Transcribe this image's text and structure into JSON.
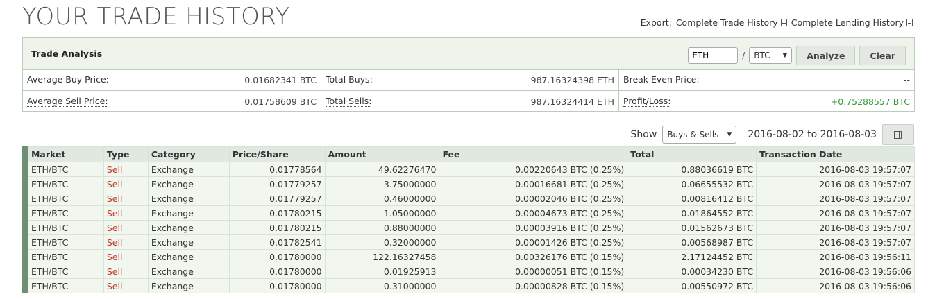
{
  "title": "YOUR TRADE HISTORY",
  "export": {
    "label": "Export:",
    "complete_trade_history": "Complete Trade History",
    "complete_lending_history": "Complete Lending History"
  },
  "analysis": {
    "title": "Trade Analysis",
    "currency_input": "ETH",
    "separator": "/",
    "base_select": "BTC",
    "analyze_label": "Analyze",
    "clear_label": "Clear",
    "rows": [
      [
        {
          "label": "Average Buy Price:",
          "value": "0.01682341 BTC"
        },
        {
          "label": "Total Buys:",
          "value": "987.16324398 ETH"
        },
        {
          "label": "Break Even Price:",
          "value": "--"
        }
      ],
      [
        {
          "label": "Average Sell Price:",
          "value": "0.01758609 BTC"
        },
        {
          "label": "Total Sells:",
          "value": "987.16324414 ETH"
        },
        {
          "label": "Profit/Loss:",
          "value": "+0.75288557 BTC"
        }
      ]
    ],
    "profit_color": "#3a9a3a"
  },
  "filter": {
    "show_label": "Show",
    "show_select": "Buys & Sells",
    "date_range": "2016-08-02 to 2016-08-03"
  },
  "table": {
    "headers": [
      "Market",
      "Type",
      "Category",
      "Price/Share",
      "Amount",
      "Fee",
      "Total",
      "Transaction Date"
    ],
    "rows": [
      [
        "ETH/BTC",
        "Sell",
        "Exchange",
        "0.01778564",
        "49.62276470",
        "0.00220643 BTC (0.25%)",
        "0.88036619 BTC",
        "2016-08-03 19:57:07"
      ],
      [
        "ETH/BTC",
        "Sell",
        "Exchange",
        "0.01779257",
        "3.75000000",
        "0.00016681 BTC (0.25%)",
        "0.06655532 BTC",
        "2016-08-03 19:57:07"
      ],
      [
        "ETH/BTC",
        "Sell",
        "Exchange",
        "0.01779257",
        "0.46000000",
        "0.00002046 BTC (0.25%)",
        "0.00816412 BTC",
        "2016-08-03 19:57:07"
      ],
      [
        "ETH/BTC",
        "Sell",
        "Exchange",
        "0.01780215",
        "1.05000000",
        "0.00004673 BTC (0.25%)",
        "0.01864552 BTC",
        "2016-08-03 19:57:07"
      ],
      [
        "ETH/BTC",
        "Sell",
        "Exchange",
        "0.01780215",
        "0.88000000",
        "0.00003916 BTC (0.25%)",
        "0.01562673 BTC",
        "2016-08-03 19:57:07"
      ],
      [
        "ETH/BTC",
        "Sell",
        "Exchange",
        "0.01782541",
        "0.32000000",
        "0.00001426 BTC (0.25%)",
        "0.00568987 BTC",
        "2016-08-03 19:57:07"
      ],
      [
        "ETH/BTC",
        "Sell",
        "Exchange",
        "0.01780000",
        "122.16327458",
        "0.00326176 BTC (0.15%)",
        "2.17124452 BTC",
        "2016-08-03 19:56:11"
      ],
      [
        "ETH/BTC",
        "Sell",
        "Exchange",
        "0.01780000",
        "0.01925913",
        "0.00000051 BTC (0.15%)",
        "0.00034230 BTC",
        "2016-08-03 19:56:06"
      ],
      [
        "ETH/BTC",
        "Sell",
        "Exchange",
        "0.01780000",
        "0.31000000",
        "0.00000828 BTC (0.15%)",
        "0.00550972 BTC",
        "2016-08-03 19:56:06"
      ]
    ]
  },
  "colors": {
    "sell": "#c0392b",
    "row_bg": "#f1f7ef",
    "header_bg": "#dfe9df",
    "accent_bar": "#6f8f73"
  }
}
